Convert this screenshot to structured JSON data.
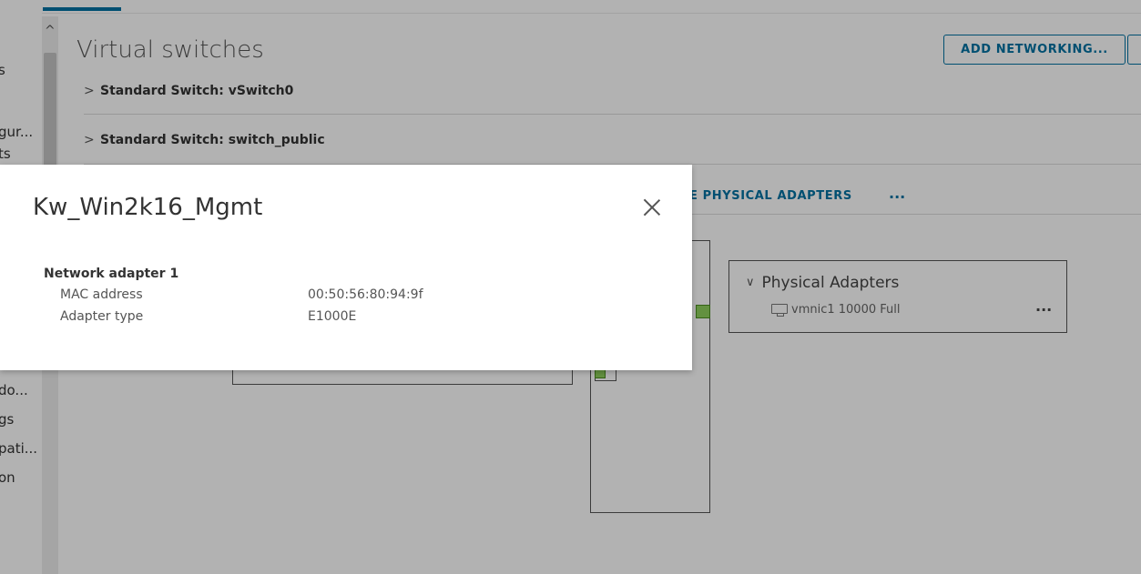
{
  "left_nav": {
    "items": [
      "s",
      "gur...",
      "ts",
      "do...",
      "gs",
      "pati...",
      "on"
    ]
  },
  "main": {
    "title": "Virtual switches",
    "add_button": "ADD NETWORKING...",
    "switches": [
      "Standard Switch: vSwitch0",
      "Standard Switch: switch_public"
    ],
    "toolbar": {
      "partial_action": "E PHYSICAL ADAPTERS",
      "more": "..."
    },
    "physical_adapters": {
      "title": "Physical Adapters",
      "item": "vmnic1 10000 Full",
      "more": "..."
    }
  },
  "modal": {
    "title": "Kw_Win2k16_Mgmt",
    "section": "Network adapter 1",
    "rows": [
      {
        "key": "MAC address",
        "value": "00:50:56:80:94:9f"
      },
      {
        "key": "Adapter type",
        "value": "E1000E"
      }
    ]
  },
  "colors": {
    "accent": "#0072a3",
    "port_green": "#8fd05c",
    "overlay": "rgba(0,0,0,0.30)"
  }
}
